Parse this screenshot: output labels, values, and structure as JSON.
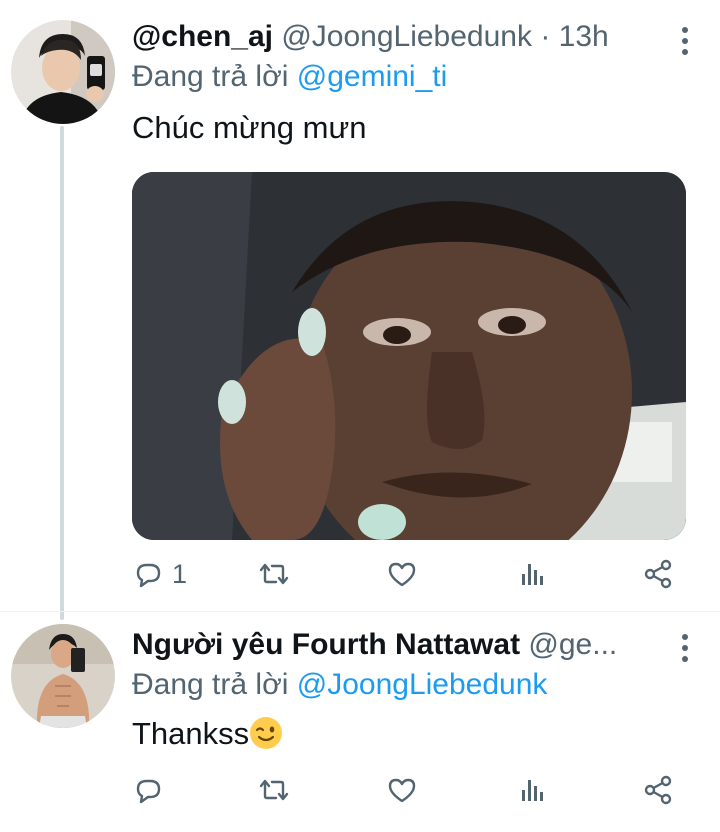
{
  "tweet1": {
    "display_name": "@chen_aj",
    "handle": "@JoongLiebedunk",
    "separator": "·",
    "time": "13h",
    "replying_prefix": "Đang trả lời",
    "replying_to": "@gemini_ti",
    "text": "Chúc mừng mưn",
    "reply_count": "1",
    "avatar_icon": "avatar-photo-icon",
    "media_icon": "video-thumbnail-icon"
  },
  "tweet2": {
    "display_name": "Người yêu Fourth Nattawat",
    "handle": "@ge...",
    "replying_prefix": "Đang trả lời",
    "replying_to": "@JoongLiebedunk",
    "text": "Thankss",
    "emoji": "winking-face",
    "avatar_icon": "avatar-photo-icon"
  },
  "icons": {
    "reply": "reply-icon",
    "retweet": "retweet-icon",
    "like": "heart-icon",
    "analytics": "analytics-icon",
    "share": "share-icon",
    "more": "more-vertical-icon"
  },
  "colors": {
    "link": "#1d9bf0",
    "secondary_text": "#536471",
    "primary_text": "#0f1419",
    "thread_line": "#cfd9de"
  }
}
